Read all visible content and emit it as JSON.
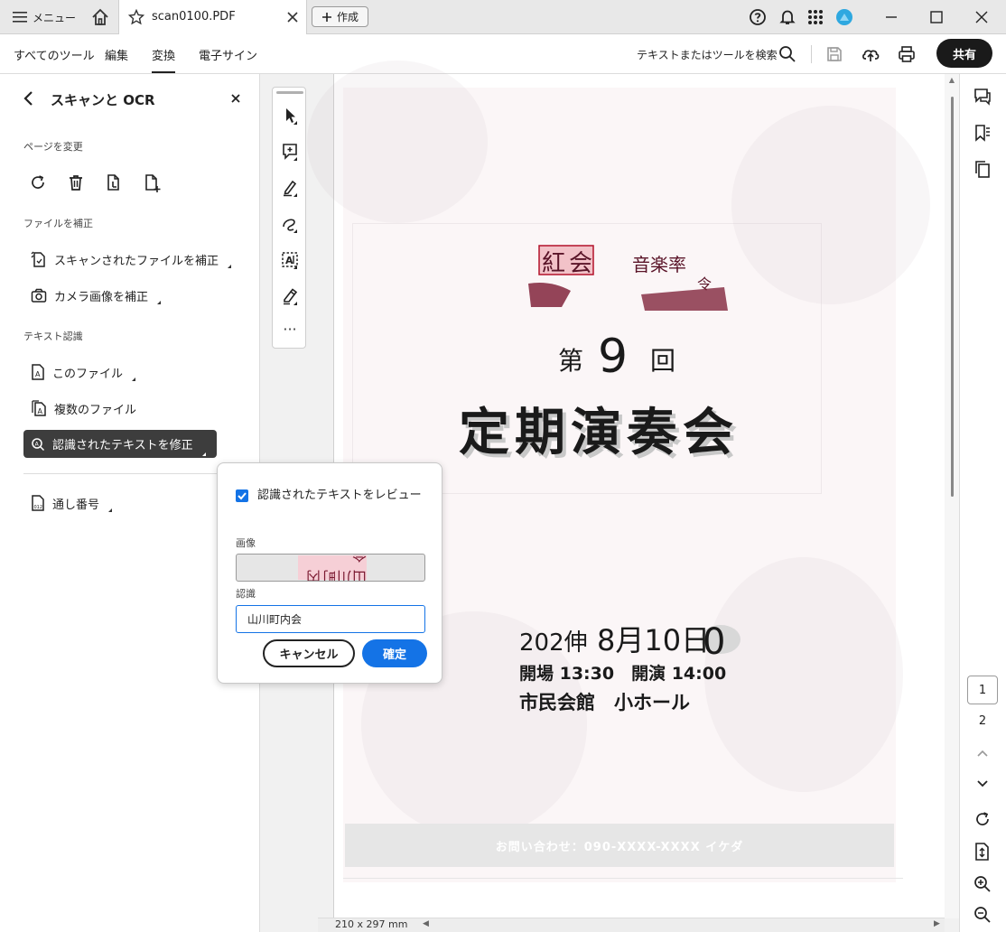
{
  "titlebar": {
    "menu_label": "メニュー",
    "tab_title": "scan0100.PDF",
    "create_label": "作成"
  },
  "menubar": {
    "items": [
      {
        "label": "すべてのツール",
        "active": false
      },
      {
        "label": "編集",
        "active": false
      },
      {
        "label": "変換",
        "active": true
      },
      {
        "label": "電子サイン",
        "active": false
      }
    ],
    "search_label": "テキストまたはツールを検索",
    "share_label": "共有"
  },
  "leftpanel": {
    "title": "スキャンと OCR",
    "sections": {
      "page_modify": "ページを変更",
      "file_fix": "ファイルを補正",
      "text_recognition": "テキスト認識"
    },
    "items": {
      "fix_scanned": "スキャンされたファイルを補正",
      "fix_camera": "カメラ画像を補正",
      "this_file": "このファイル",
      "multiple_files": "複数のファイル",
      "fix_recognized": "認識されたテキストを修正",
      "bates": "通し番号"
    }
  },
  "popup": {
    "checkbox_label": "認識されたテキストをレビュー",
    "checkbox_checked": true,
    "image_label": "画像",
    "image_text": "山川町内会",
    "recognition_label": "認識",
    "recognition_value": "山川町内会",
    "cancel_label": "キャンセル",
    "ok_label": "確定"
  },
  "document": {
    "line_top_left": "紅",
    "line_top_left2": "会",
    "line_top_right": "音楽率",
    "line_top_small": "令",
    "edition_prefix": "第",
    "edition_number": "9",
    "edition_suffix": "回",
    "main_title": "定期演奏会",
    "date_year": "202伸",
    "date_month_day": "8月10日",
    "date_extra": "0",
    "times": "開場 13:30　開演 14:00",
    "venue": "市民会館　小ホール",
    "contact": "お問い合わせ：090-XXXX-XXXX イケダ"
  },
  "statusbar": {
    "page_size": "210 x 297 mm"
  },
  "pagenav": {
    "current_page": "1",
    "next_page": "2"
  },
  "colors": {
    "accent": "#1473e6",
    "selected_item_bg": "#3d3d3d",
    "share_bg": "#1a1a1a",
    "avatar": "#2ea8e0"
  }
}
